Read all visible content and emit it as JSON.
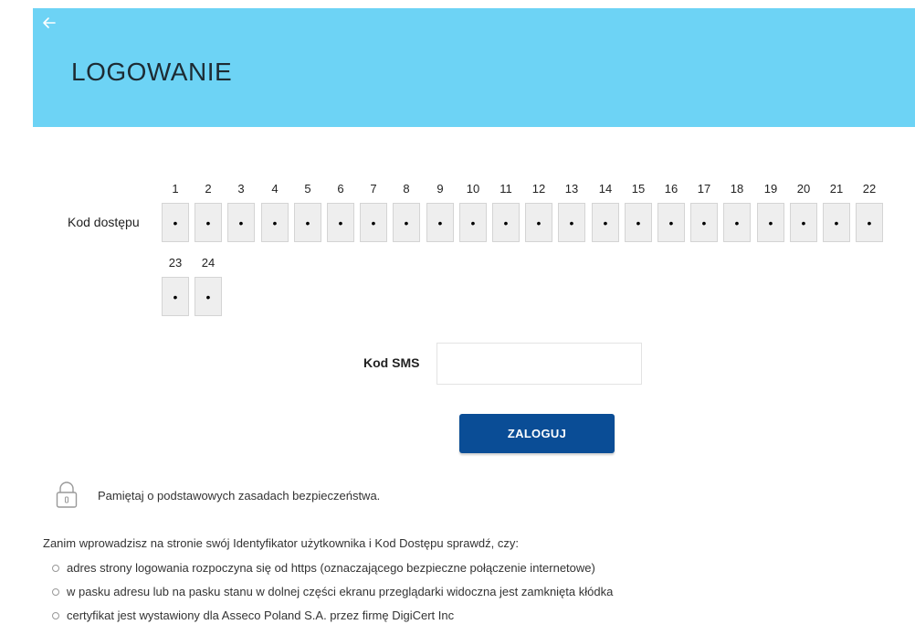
{
  "header": {
    "title": "LOGOWANIE",
    "back_icon": "arrow-left-icon",
    "background_color": "#6dd3f5"
  },
  "access_code": {
    "label": "Kod dostępu",
    "mask_char": "•",
    "positions": [
      "1",
      "2",
      "3",
      "4",
      "5",
      "6",
      "7",
      "8",
      "9",
      "10",
      "11",
      "12",
      "13",
      "14",
      "15",
      "16",
      "17",
      "18",
      "19",
      "20",
      "21",
      "22",
      "23",
      "24"
    ]
  },
  "sms": {
    "label": "Kod SMS",
    "value": "",
    "placeholder": ""
  },
  "login_button": {
    "label": "ZALOGUJ",
    "color": "#0a4d96"
  },
  "security": {
    "icon": "lock-icon",
    "note": "Pamiętaj o podstawowych zasadach bezpieczeństwa.",
    "intro": "Zanim wprowadzisz na stronie swój Identyfikator użytkownika i Kod Dostępu sprawdź, czy:",
    "checks": [
      "adres strony logowania rozpoczyna się od https (oznaczającego bezpieczne połączenie internetowe)",
      "w pasku adresu lub na pasku stanu w dolnej części ekranu przeglądarki widoczna jest zamknięta kłódka",
      "certyfikat jest wystawiony dla Asseco Poland S.A. przez firmę DigiCert Inc"
    ]
  }
}
